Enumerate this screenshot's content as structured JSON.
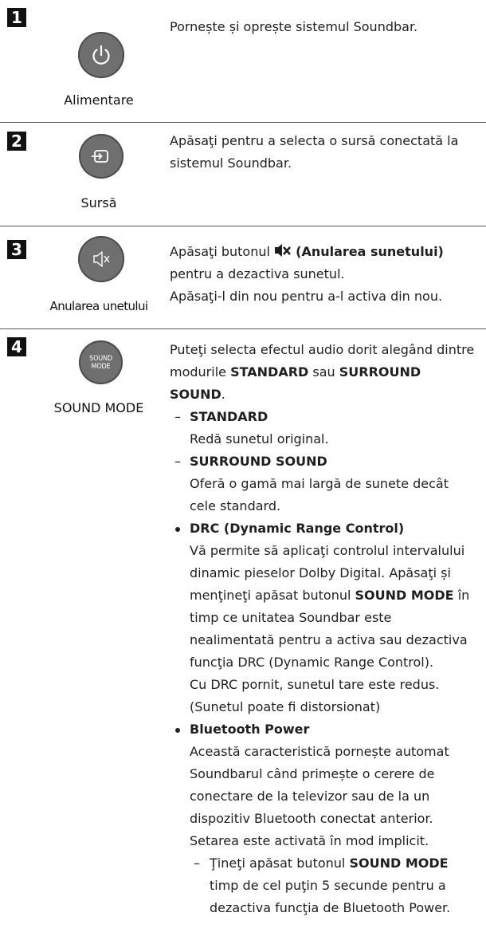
{
  "rows": [
    {
      "number": "1",
      "icon": "power-icon",
      "caption": "Alimentare",
      "description": "Pornește și oprește sistemul Soundbar."
    },
    {
      "number": "2",
      "icon": "source-icon",
      "caption": "Sursă",
      "description": "Apăsaţi pentru a selecta o sursă conectată la sistemul Soundbar."
    },
    {
      "number": "3",
      "icon": "mute-icon",
      "caption": "Anularea unetului",
      "desc_line1_prefix": "Apăsaţi butonul ",
      "desc_line1_bold": "(Anularea sunetului)",
      "desc_line2": "pentru a dezactiva sunetul.",
      "desc_line3": "Apăsaţi-l din nou pentru a-l activa din nou."
    },
    {
      "number": "4",
      "icon": "sound-mode-icon",
      "button_text": "SOUND MODE",
      "button_text_line1": "SOUND",
      "button_text_line2": "MODE",
      "caption": "SOUND MODE",
      "intro_prefix": "Puteţi selecta efectul audio dorit alegând dintre modurile ",
      "intro_bold1": "STANDARD",
      "intro_mid": " sau ",
      "intro_bold2": "SURROUND SOUND",
      "intro_end": ".",
      "modes": [
        {
          "dash": "–",
          "title": "STANDARD",
          "text": "Redă sunetul original."
        },
        {
          "dash": "–",
          "title": "SURROUND SOUND",
          "text": "Oferă o gamă mai largă de sunete decât cele standard."
        }
      ],
      "drc_title": "DRC (Dynamic Range Control)",
      "drc_text_prefix": "Vă permite să aplicaţi controlul intervalului dinamic pieselor Dolby Digital. Apăsaţi și menţineţi apăsat butonul ",
      "drc_text_bold": "SOUND MODE",
      "drc_text_suffix": " în timp ce unitatea Soundbar este nealimentată pentru a activa sau dezactiva funcţia DRC (Dynamic Range Control).",
      "drc_note1": "Cu DRC pornit, sunetul tare este redus.",
      "drc_note2": "(Sunetul poate fi distorsionat)",
      "bt_title": "Bluetooth Power",
      "bt_text": "Această caracteristică pornește automat Soundbarul când primește o cerere de conectare de la televizor sau de la un dispozitiv Bluetooth conectat anterior. Setarea este activată în mod implicit.",
      "bt_sub_dash": "–",
      "bt_sub_prefix": "Ţineţi apăsat butonul ",
      "bt_sub_bold": "SOUND MODE",
      "bt_sub_suffix": " timp de cel puţin 5 secunde pentru a dezactiva funcţia de Bluetooth Power."
    }
  ]
}
